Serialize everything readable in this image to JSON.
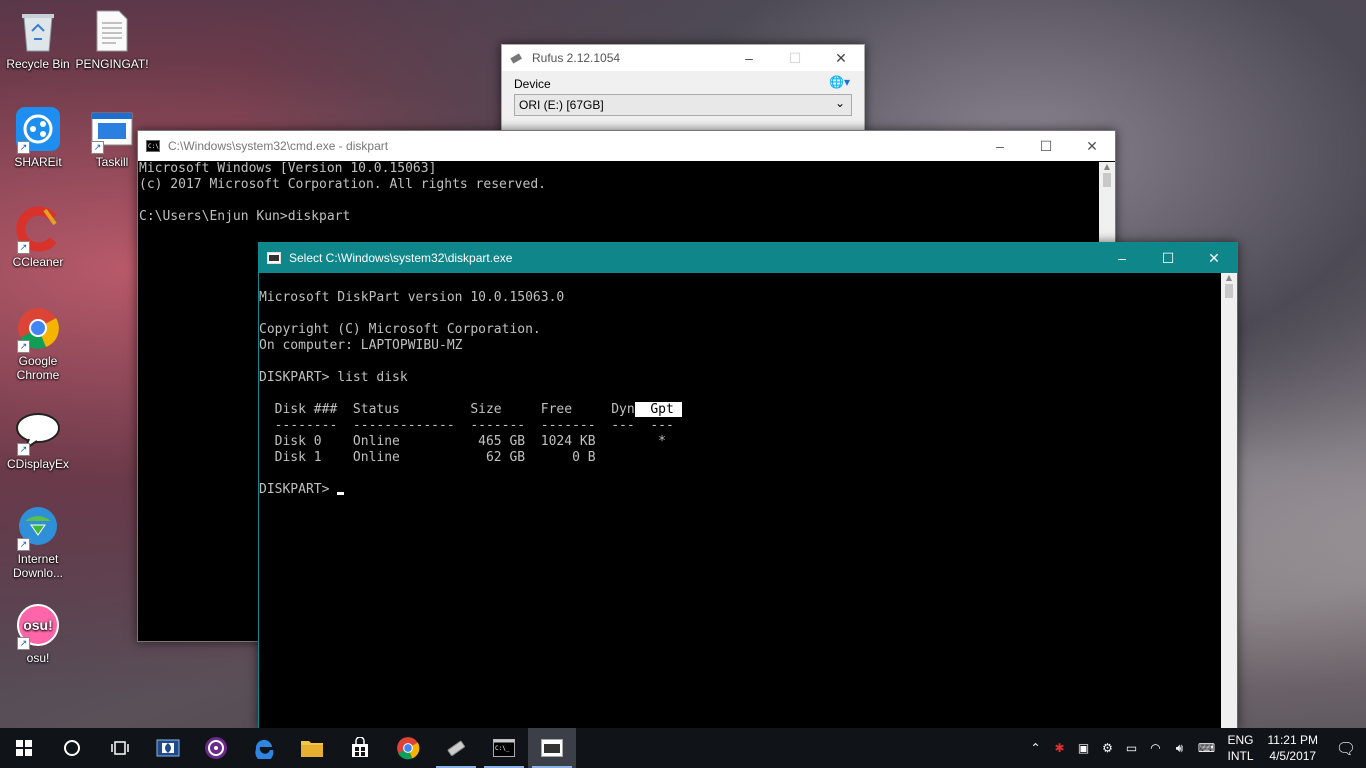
{
  "desktop": {
    "icons": [
      {
        "label": "Recycle Bin",
        "icon": "recycle-bin-icon"
      },
      {
        "label": "PENGINGAT!",
        "icon": "text-file-icon"
      },
      {
        "label": "SHAREit",
        "icon": "shareit-icon"
      },
      {
        "label": "Taskill",
        "icon": "taskill-icon"
      },
      {
        "label": "CCleaner",
        "icon": "ccleaner-icon"
      },
      {
        "label": "Google Chrome",
        "icon": "chrome-icon"
      },
      {
        "label": "CDisplayEx",
        "icon": "cdisplayex-icon"
      },
      {
        "label": "Internet Downlo...",
        "icon": "idm-icon"
      },
      {
        "label": "osu!",
        "icon": "osu-icon"
      }
    ]
  },
  "rufus": {
    "title": "Rufus 2.12.1054",
    "device_label": "Device",
    "device_value": "ORI (E:) [67GB]"
  },
  "cmd": {
    "title": "C:\\Windows\\system32\\cmd.exe - diskpart",
    "lines": [
      "Microsoft Windows [Version 10.0.15063]",
      "(c) 2017 Microsoft Corporation. All rights reserved.",
      "",
      "C:\\Users\\Enjun Kun>diskpart"
    ]
  },
  "diskpart": {
    "title": "Select C:\\Windows\\system32\\diskpart.exe",
    "header_lines": [
      "Microsoft DiskPart version 10.0.15063.0",
      "",
      "Copyright (C) Microsoft Corporation.",
      "On computer: LAPTOPWIBU-MZ",
      "",
      "DISKPART> list disk",
      ""
    ],
    "table_header_prefix": "  Disk ###  Status         Size     Free     Dyn",
    "table_header_selected": "  Gpt ",
    "table_separator": "  --------  -------------  -------  -------  ---  ---",
    "disks": [
      "  Disk 0    Online          465 GB  1024 KB        *",
      "  Disk 1    Online           62 GB      0 B"
    ],
    "prompt": "DISKPART> "
  },
  "taskbar": {
    "apps": [
      "start-icon",
      "cortana-icon",
      "task-view-icon",
      "dolby-icon",
      "media-player-icon",
      "edge-icon",
      "file-explorer-icon",
      "store-icon",
      "chrome-icon",
      "usb-drive-icon",
      "cmd-icon",
      "diskpart-icon"
    ],
    "lang_top": "ENG",
    "lang_bottom": "INTL",
    "time": "11:21 PM",
    "date": "4/5/2017"
  }
}
